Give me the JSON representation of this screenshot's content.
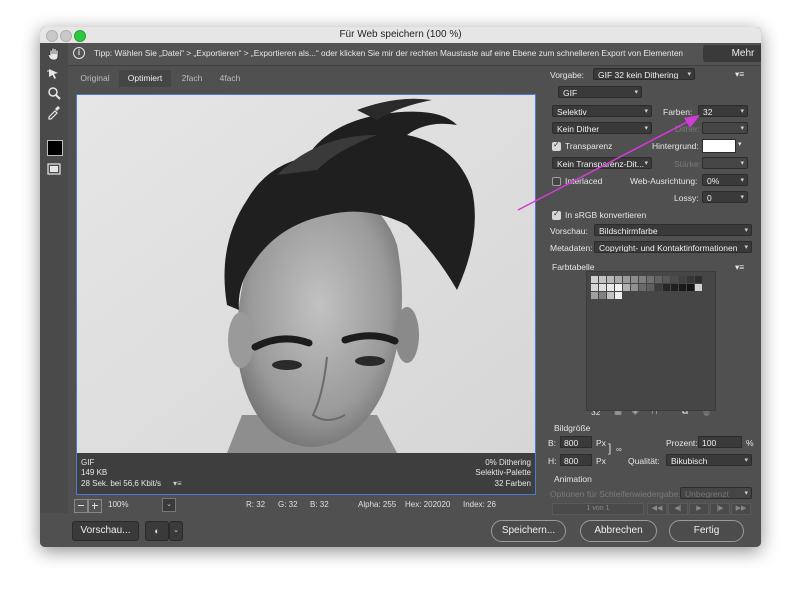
{
  "window": {
    "title": "Für Web speichern (100 %)"
  },
  "tip": {
    "text": "Tipp: Wählen Sie „Datei“ > „Exportieren“ > „Exportieren als...“ oder klicken Sie mir der rechten Maustaste auf eine Ebene zum schnelleren Export von Elementen",
    "more_label": "Mehr"
  },
  "tools": [
    "hand-tool",
    "slice-select-tool",
    "zoom-tool",
    "eyedropper-tool",
    "eyedropper-color",
    "toggle-slices-visibility"
  ],
  "tabs": [
    {
      "label": "Original",
      "active": false
    },
    {
      "label": "Optimiert",
      "active": true
    },
    {
      "label": "2fach",
      "active": false
    },
    {
      "label": "4fach",
      "active": false
    }
  ],
  "preview_info": {
    "format": "GIF",
    "size": "149 KB",
    "time": "28 Sek. bei 56,6 Kbit/s",
    "dithering": "0% Dithering",
    "palette": "Selektiv-Palette",
    "colors": "32 Farben"
  },
  "status": {
    "zoom": "100%",
    "r": "R: 32",
    "g": "G: 32",
    "b": "B: 32",
    "alpha": "Alpha: 255",
    "hex": "Hex: 202020",
    "index": "Index: 26"
  },
  "bottom": {
    "preview_label": "Vorschau...",
    "save_label": "Speichern...",
    "cancel_label": "Abbrechen",
    "done_label": "Fertig"
  },
  "settings": {
    "preset_label": "Vorgabe:",
    "preset_value": "GIF 32 kein Dithering",
    "format_value": "GIF",
    "reduction_value": "Selektiv",
    "colors_label": "Farben:",
    "colors_value": "32",
    "dither_value": "Kein Dither",
    "dither_label": "Dither:",
    "transparency_label": "Transparenz",
    "transparency_checked": true,
    "matte_label": "Hintergrund:",
    "transparency_dither_value": "Kein Transparenz-Dit...",
    "amount_label": "Stärke:",
    "interlaced_label": "Interlaced",
    "interlaced_checked": false,
    "websnap_label": "Web-Ausrichtung:",
    "websnap_value": "0%",
    "lossy_label": "Lossy:",
    "lossy_value": "0",
    "srgb_label": "In sRGB konvertieren",
    "srgb_checked": true,
    "preview_label": "Vorschau:",
    "preview_value": "Bildschirmfarbe",
    "metadata_label": "Metadaten:",
    "metadata_value": "Copyright- und Kontaktinformationen"
  },
  "color_table": {
    "title": "Farbtabelle",
    "count": "32",
    "swatches": [
      "#cfcfcf",
      "#c4c4c4",
      "#b8b8b8",
      "#a9a9a9",
      "#9a9a9a",
      "#8c8c8c",
      "#7e7e7e",
      "#707070",
      "#636363",
      "#575757",
      "#4c4c4c",
      "#414141",
      "#373737",
      "#2e2e2e",
      "#d6d6d6",
      "#e0e0e0",
      "#e9e9e9",
      "#f2f2f2",
      "#b0b0b0",
      "#909090",
      "#6a6a6a",
      "#5e5e5e",
      "#3c3c3c",
      "#262626",
      "#202020",
      "#1a1a1a",
      "#151515",
      "#d0d0d0",
      "#a0a0a0",
      "#808080",
      "#c0c0c0",
      "#ececec"
    ]
  },
  "image_size": {
    "title": "Bildgröße",
    "w_label": "B:",
    "w_value": "800",
    "h_label": "H:",
    "h_value": "800",
    "unit": "Px",
    "percent_label": "Prozent:",
    "percent_value": "100",
    "percent_unit": "%",
    "quality_label": "Qualität:",
    "quality_value": "Bikubisch"
  },
  "animation": {
    "title": "Animation",
    "loop_label": "Optionen für Schleifenwiedergabe:",
    "loop_value": "Unbegrenzt",
    "frame_counter": "1 von 1"
  },
  "colors": {
    "accent": "#4a7bd0",
    "annotation": "#d13cd6",
    "panel": "#505050"
  }
}
